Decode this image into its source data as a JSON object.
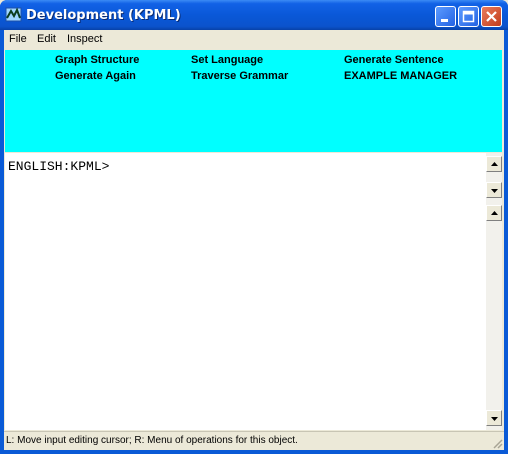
{
  "window": {
    "title": "Development (KPML)"
  },
  "menu": [
    "File",
    "Edit",
    "Inspect"
  ],
  "commands": {
    "graph_structure": "Graph Structure",
    "set_language": "Set Language",
    "generate_sentence": "Generate Sentence",
    "generate_again": "Generate Again",
    "traverse_grammar": "Traverse Grammar",
    "example_manager": "EXAMPLE MANAGER"
  },
  "listener": {
    "prompt": "ENGLISH:KPML>"
  },
  "status": {
    "text": "L: Move input editing cursor; R: Menu of operations for this object."
  },
  "colors": {
    "titlebar": "#0a58d8",
    "command_pane": "#00ffff",
    "listener_bg": "#ffffff",
    "chrome": "#ece9d8"
  },
  "icons": [
    "app-icon",
    "minimize-icon",
    "maximize-icon",
    "close-icon",
    "scroll-up-icon",
    "scroll-down-icon",
    "resize-grip-icon"
  ]
}
